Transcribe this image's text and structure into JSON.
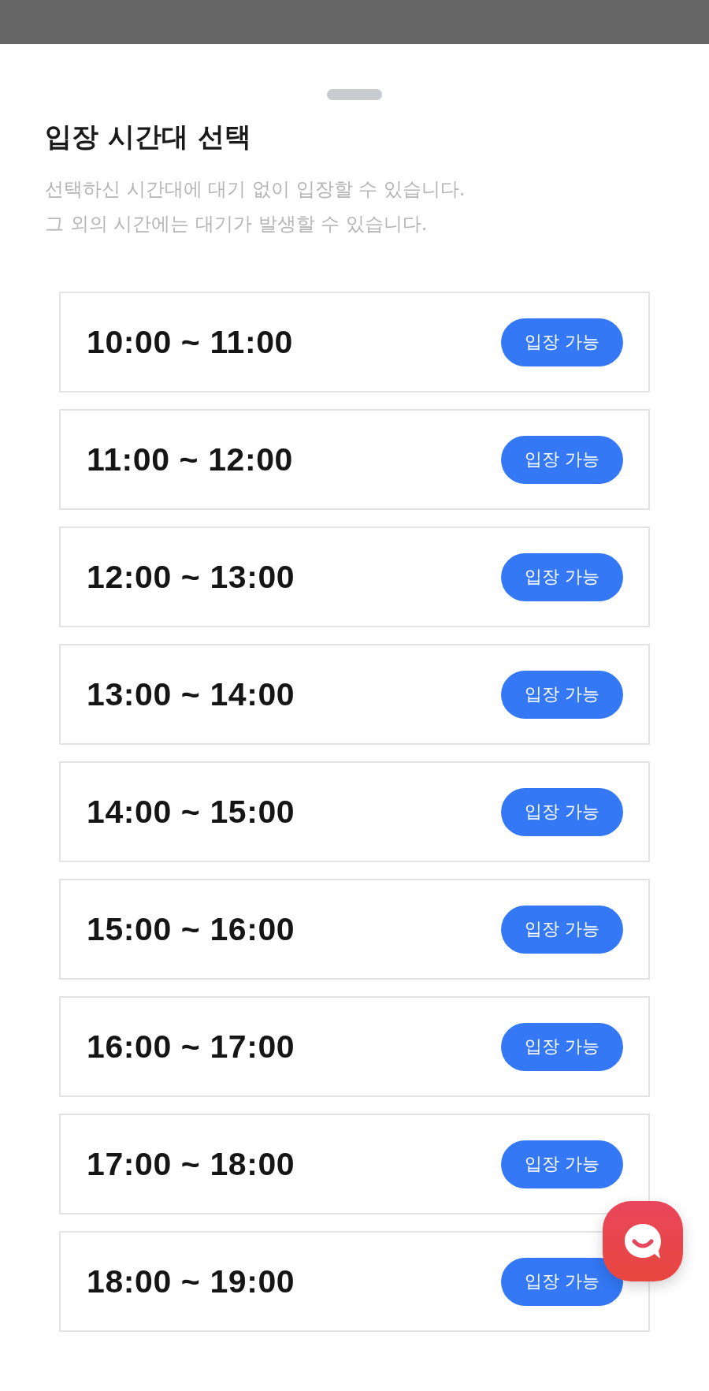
{
  "sheet": {
    "title": "입장 시간대 선택",
    "description": [
      "선택하신 시간대에 대기 없이 입장할 수 있습니다.",
      "그 외의 시간에는 대기가 발생할 수 있습니다."
    ]
  },
  "slots": [
    {
      "time": "10:00 ~ 11:00",
      "status": "입장 가능"
    },
    {
      "time": "11:00 ~ 12:00",
      "status": "입장 가능"
    },
    {
      "time": "12:00 ~ 13:00",
      "status": "입장 가능"
    },
    {
      "time": "13:00 ~ 14:00",
      "status": "입장 가능"
    },
    {
      "time": "14:00 ~ 15:00",
      "status": "입장 가능"
    },
    {
      "time": "15:00 ~ 16:00",
      "status": "입장 가능"
    },
    {
      "time": "16:00 ~ 17:00",
      "status": "입장 가능"
    },
    {
      "time": "17:00 ~ 18:00",
      "status": "입장 가능"
    },
    {
      "time": "18:00 ~ 19:00",
      "status": "입장 가능"
    }
  ]
}
